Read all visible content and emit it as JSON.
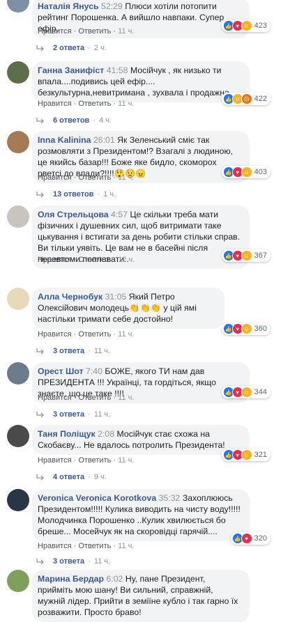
{
  "actions": {
    "like": "Нравится",
    "reply": "Ответить",
    "dot": "·"
  },
  "comments": [
    {
      "author": "Наталія Янусь",
      "ts": "52:29",
      "text": "Плюси хотіли потопити рейтинг Порошенка. А вийшло навпаки. Супер ефір.",
      "age": "11 ч.",
      "reactions": [
        "like-icon",
        "love-icon",
        "haha-icon"
      ],
      "count": "423",
      "replies": "2 ответа",
      "replies_age": "2 ч."
    },
    {
      "author": "Ганна Занифіст",
      "ts": "41:58",
      "text": "Мосійчук , як низько ти впала....подивись цей ефір.... безкультурна,невитримана , зухвала і продажна....",
      "age": "11 ч.",
      "reactions": [
        "like-icon",
        "haha-icon",
        "angry-icon"
      ],
      "count": "422",
      "replies": "6 ответов",
      "replies_age": "4 ч."
    },
    {
      "author": "Inna Kalinina",
      "ts": "26:01",
      "text": "Як Зеленський сміє так розмовляти з Президентом!? Взагалі з людиною, це якийсь базар!!! Боже яке бидло, скоморох рветсі до влади?!!!!😲😟😠",
      "age": "11 ч.",
      "reactions": [
        "like-icon",
        "love-icon",
        "haha-icon"
      ],
      "count": "403",
      "replies": "13 ответов",
      "replies_age": "1 ч."
    },
    {
      "author": "Оля Стрельцова",
      "ts": "4:57",
      "text": "Це скільки треба мати фізичних і душевних сил, щоб витримати таке цькування і встигати за день робити стільки справ. Ви тільки уявіть. Це вам не в басейні після перевтоми поплавати..",
      "age": "12 ч.",
      "reactions": [
        "like-icon",
        "love-icon",
        "haha-icon"
      ],
      "count": "367",
      "replies": "",
      "replies_age": ""
    },
    {
      "author": "Алла Чернобук",
      "ts": "31:05",
      "text": "Який Петро Олексійович молодець👏👏👏 у цій ямі настільки тримати себе достойно!",
      "age": "11 ч.",
      "reactions": [
        "like-icon",
        "love-icon",
        "haha-icon"
      ],
      "count": "360",
      "replies": "3 ответа",
      "replies_age": "11 ч."
    },
    {
      "author": "Орест Шот",
      "ts": "7:40",
      "text": "БОЖЕ, якого ТИ нам дав ПРЕЗИДЕНТА !!! Українці, та гордіться, якщо знаєте, що це таке !!!!",
      "age": "11 ч.",
      "reactions": [
        "like-icon",
        "love-icon",
        "haha-icon"
      ],
      "count": "344",
      "replies": "3 ответа",
      "replies_age": "11 ч."
    },
    {
      "author": "Таня Поліщук",
      "ts": "2:08",
      "text": "Мосійчук стає схожа на Скобаєву... Не вдалось потролить Президента!",
      "age": "11 ч.",
      "reactions": [
        "like-icon",
        "love-icon",
        "haha-icon"
      ],
      "count": "321",
      "replies": "4 ответа",
      "replies_age": "9 ч."
    },
    {
      "author": "Veronica Veronica Korotkova",
      "ts": "35:32",
      "text": "Захоплююсь Президентом!!!!! Кулика виводить на чисту воду!!!!! Молодчинка Порошенко ..Кулик хвилюється бо бреше... Мосейчук як на скоровідці гарячій....",
      "age": "11 ч.",
      "reactions": [
        "like-icon",
        "love-icon"
      ],
      "count": "320",
      "replies": "3 ответа",
      "replies_age": "11 ч."
    },
    {
      "author": "Марина Бердар",
      "ts": "6:02",
      "text": "Ну, пане Президент, прийміть мою шану! Ви сильний, справжній, мужній лідер. Прийти в земіїне кубло і так гарно їх розважити. Просто браво!",
      "age": "",
      "reactions": [],
      "count": "",
      "replies": "",
      "replies_age": ""
    }
  ]
}
